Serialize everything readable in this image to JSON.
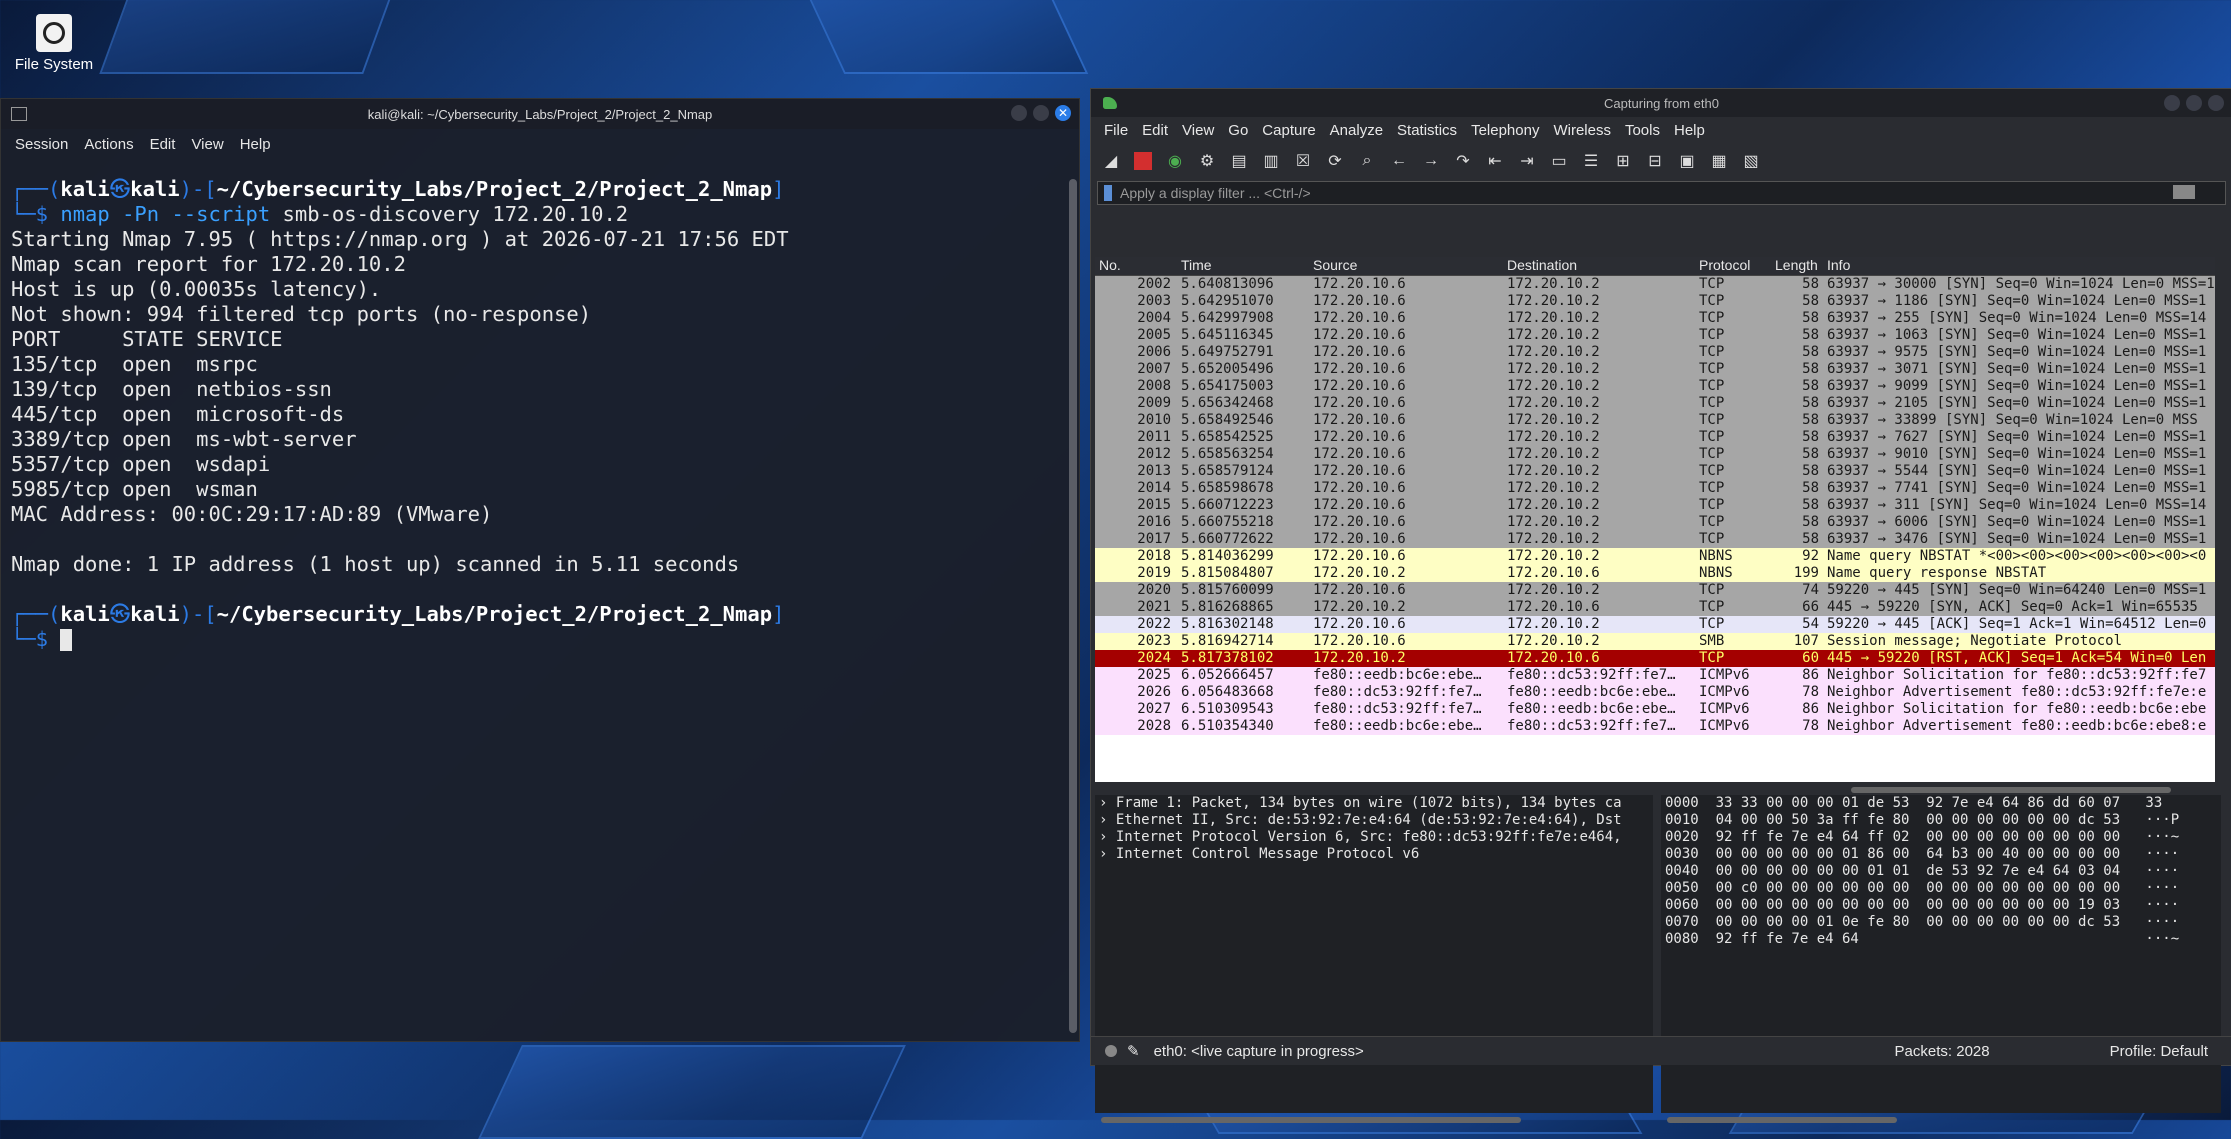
{
  "desktop": {
    "icon_label": "File System"
  },
  "terminal": {
    "title": "kali@kali: ~/Cybersecurity_Labs/Project_2/Project_2_Nmap",
    "menu": [
      "Session",
      "Actions",
      "Edit",
      "View",
      "Help"
    ],
    "prompt_user": "kali",
    "prompt_host": "kali",
    "prompt_path": "~/Cybersecurity_Labs/Project_2/Project_2_Nmap",
    "command_bin": "nmap",
    "command_args": "-Pn --script",
    "command_rest": "smb-os-discovery 172.20.10.2",
    "output": [
      "Starting Nmap 7.95 ( https://nmap.org ) at 2026-07-21 17:56 EDT",
      "Nmap scan report for 172.20.10.2",
      "Host is up (0.00035s latency).",
      "Not shown: 994 filtered tcp ports (no-response)",
      "PORT     STATE SERVICE",
      "135/tcp  open  msrpc",
      "139/tcp  open  netbios-ssn",
      "445/tcp  open  microsoft-ds",
      "3389/tcp open  ms-wbt-server",
      "5357/tcp open  wsdapi",
      "5985/tcp open  wsman",
      "MAC Address: 00:0C:29:17:AD:89 (VMware)",
      "",
      "Nmap done: 1 IP address (1 host up) scanned in 5.11 seconds"
    ]
  },
  "wireshark": {
    "title": "Capturing from eth0",
    "menu": [
      "File",
      "Edit",
      "View",
      "Go",
      "Capture",
      "Analyze",
      "Statistics",
      "Telephony",
      "Wireless",
      "Tools",
      "Help"
    ],
    "filter_placeholder": "Apply a display filter ... <Ctrl-/>",
    "columns": [
      "No.",
      "Time",
      "Source",
      "Destination",
      "Protocol",
      "Length",
      "Info"
    ],
    "packets": [
      {
        "no": "2002",
        "time": "5.640813096",
        "src": "172.20.10.6",
        "dst": "172.20.10.2",
        "proto": "TCP",
        "len": "58",
        "info": "63937 → 30000 [SYN] Seq=0 Win=1024 Len=0 MSS=1",
        "color": "#a6a6a6"
      },
      {
        "no": "2003",
        "time": "5.642951070",
        "src": "172.20.10.6",
        "dst": "172.20.10.2",
        "proto": "TCP",
        "len": "58",
        "info": "63937 → 1186 [SYN] Seq=0 Win=1024 Len=0 MSS=1",
        "color": "#a6a6a6"
      },
      {
        "no": "2004",
        "time": "5.642997908",
        "src": "172.20.10.6",
        "dst": "172.20.10.2",
        "proto": "TCP",
        "len": "58",
        "info": "63937 → 255 [SYN] Seq=0 Win=1024 Len=0 MSS=14",
        "color": "#a6a6a6"
      },
      {
        "no": "2005",
        "time": "5.645116345",
        "src": "172.20.10.6",
        "dst": "172.20.10.2",
        "proto": "TCP",
        "len": "58",
        "info": "63937 → 1063 [SYN] Seq=0 Win=1024 Len=0 MSS=1",
        "color": "#a6a6a6"
      },
      {
        "no": "2006",
        "time": "5.649752791",
        "src": "172.20.10.6",
        "dst": "172.20.10.2",
        "proto": "TCP",
        "len": "58",
        "info": "63937 → 9575 [SYN] Seq=0 Win=1024 Len=0 MSS=1",
        "color": "#a6a6a6"
      },
      {
        "no": "2007",
        "time": "5.652005496",
        "src": "172.20.10.6",
        "dst": "172.20.10.2",
        "proto": "TCP",
        "len": "58",
        "info": "63937 → 3071 [SYN] Seq=0 Win=1024 Len=0 MSS=1",
        "color": "#a6a6a6"
      },
      {
        "no": "2008",
        "time": "5.654175003",
        "src": "172.20.10.6",
        "dst": "172.20.10.2",
        "proto": "TCP",
        "len": "58",
        "info": "63937 → 9099 [SYN] Seq=0 Win=1024 Len=0 MSS=1",
        "color": "#a6a6a6"
      },
      {
        "no": "2009",
        "time": "5.656342468",
        "src": "172.20.10.6",
        "dst": "172.20.10.2",
        "proto": "TCP",
        "len": "58",
        "info": "63937 → 2105 [SYN] Seq=0 Win=1024 Len=0 MSS=1",
        "color": "#a6a6a6"
      },
      {
        "no": "2010",
        "time": "5.658492546",
        "src": "172.20.10.6",
        "dst": "172.20.10.2",
        "proto": "TCP",
        "len": "58",
        "info": "63937 → 33899 [SYN] Seq=0 Win=1024 Len=0 MSS",
        "color": "#a6a6a6"
      },
      {
        "no": "2011",
        "time": "5.658542525",
        "src": "172.20.10.6",
        "dst": "172.20.10.2",
        "proto": "TCP",
        "len": "58",
        "info": "63937 → 7627 [SYN] Seq=0 Win=1024 Len=0 MSS=1",
        "color": "#a6a6a6"
      },
      {
        "no": "2012",
        "time": "5.658563254",
        "src": "172.20.10.6",
        "dst": "172.20.10.2",
        "proto": "TCP",
        "len": "58",
        "info": "63937 → 9010 [SYN] Seq=0 Win=1024 Len=0 MSS=1",
        "color": "#a6a6a6"
      },
      {
        "no": "2013",
        "time": "5.658579124",
        "src": "172.20.10.6",
        "dst": "172.20.10.2",
        "proto": "TCP",
        "len": "58",
        "info": "63937 → 5544 [SYN] Seq=0 Win=1024 Len=0 MSS=1",
        "color": "#a6a6a6"
      },
      {
        "no": "2014",
        "time": "5.658598678",
        "src": "172.20.10.6",
        "dst": "172.20.10.2",
        "proto": "TCP",
        "len": "58",
        "info": "63937 → 7741 [SYN] Seq=0 Win=1024 Len=0 MSS=1",
        "color": "#a6a6a6"
      },
      {
        "no": "2015",
        "time": "5.660712223",
        "src": "172.20.10.6",
        "dst": "172.20.10.2",
        "proto": "TCP",
        "len": "58",
        "info": "63937 → 311 [SYN] Seq=0 Win=1024 Len=0 MSS=14",
        "color": "#a6a6a6"
      },
      {
        "no": "2016",
        "time": "5.660755218",
        "src": "172.20.10.6",
        "dst": "172.20.10.2",
        "proto": "TCP",
        "len": "58",
        "info": "63937 → 6006 [SYN] Seq=0 Win=1024 Len=0 MSS=1",
        "color": "#a6a6a6"
      },
      {
        "no": "2017",
        "time": "5.660772622",
        "src": "172.20.10.6",
        "dst": "172.20.10.2",
        "proto": "TCP",
        "len": "58",
        "info": "63937 → 3476 [SYN] Seq=0 Win=1024 Len=0 MSS=1",
        "color": "#a6a6a6"
      },
      {
        "no": "2018",
        "time": "5.814036299",
        "src": "172.20.10.6",
        "dst": "172.20.10.2",
        "proto": "NBNS",
        "len": "92",
        "info": "Name query NBSTAT *<00><00><00><00><00><00><0",
        "color": "#fefec4"
      },
      {
        "no": "2019",
        "time": "5.815084807",
        "src": "172.20.10.2",
        "dst": "172.20.10.6",
        "proto": "NBNS",
        "len": "199",
        "info": "Name query response NBSTAT",
        "color": "#fefec4"
      },
      {
        "no": "2020",
        "time": "5.815760099",
        "src": "172.20.10.6",
        "dst": "172.20.10.2",
        "proto": "TCP",
        "len": "74",
        "info": "59220 → 445 [SYN] Seq=0 Win=64240 Len=0 MSS=1",
        "color": "#a6a6a6"
      },
      {
        "no": "2021",
        "time": "5.816268865",
        "src": "172.20.10.2",
        "dst": "172.20.10.6",
        "proto": "TCP",
        "len": "66",
        "info": "445 → 59220 [SYN, ACK] Seq=0 Ack=1 Win=65535",
        "color": "#a6a6a6"
      },
      {
        "no": "2022",
        "time": "5.816302148",
        "src": "172.20.10.6",
        "dst": "172.20.10.2",
        "proto": "TCP",
        "len": "54",
        "info": "59220 → 445 [ACK] Seq=1 Ack=1 Win=64512 Len=0",
        "color": "#e6e6f8"
      },
      {
        "no": "2023",
        "time": "5.816942714",
        "src": "172.20.10.6",
        "dst": "172.20.10.2",
        "proto": "SMB",
        "len": "107",
        "info": "Session message; Negotiate Protocol",
        "color": "#fefec4"
      },
      {
        "no": "2024",
        "time": "5.817378102",
        "src": "172.20.10.2",
        "dst": "172.20.10.6",
        "proto": "TCP",
        "len": "60",
        "info": "445 → 59220 [RST, ACK] Seq=1 Ack=54 Win=0 Len",
        "color": "#a40000",
        "fg": "#ffff66"
      },
      {
        "no": "2025",
        "time": "6.052666457",
        "src": "fe80::eedb:bc6e:ebe…",
        "dst": "fe80::dc53:92ff:fe7…",
        "proto": "ICMPv6",
        "len": "86",
        "info": "Neighbor Solicitation for fe80::dc53:92ff:fe7",
        "color": "#fbe0fd"
      },
      {
        "no": "2026",
        "time": "6.056483668",
        "src": "fe80::dc53:92ff:fe7…",
        "dst": "fe80::eedb:bc6e:ebe…",
        "proto": "ICMPv6",
        "len": "78",
        "info": "Neighbor Advertisement fe80::dc53:92ff:fe7e:e",
        "color": "#fbe0fd"
      },
      {
        "no": "2027",
        "time": "6.510309543",
        "src": "fe80::dc53:92ff:fe7…",
        "dst": "fe80::eedb:bc6e:ebe…",
        "proto": "ICMPv6",
        "len": "86",
        "info": "Neighbor Solicitation for fe80::eedb:bc6e:ebe",
        "color": "#fbe0fd"
      },
      {
        "no": "2028",
        "time": "6.510354340",
        "src": "fe80::eedb:bc6e:ebe…",
        "dst": "fe80::dc53:92ff:fe7…",
        "proto": "ICMPv6",
        "len": "78",
        "info": "Neighbor Advertisement fe80::eedb:bc6e:ebe8:e",
        "color": "#fbe0fd"
      }
    ],
    "details": [
      "Frame 1: Packet, 134 bytes on wire (1072 bits), 134 bytes ca",
      "Ethernet II, Src: de:53:92:7e:e4:64 (de:53:92:7e:e4:64), Dst",
      "Internet Protocol Version 6, Src: fe80::dc53:92ff:fe7e:e464,",
      "Internet Control Message Protocol v6"
    ],
    "hex": [
      "0000  33 33 00 00 00 01 de 53  92 7e e4 64 86 dd 60 07   33",
      "0010  04 00 00 50 3a ff fe 80  00 00 00 00 00 00 dc 53   ···P",
      "0020  92 ff fe 7e e4 64 ff 02  00 00 00 00 00 00 00 00   ···~",
      "0030  00 00 00 00 00 01 86 00  64 b3 00 40 00 00 00 00   ····",
      "0040  00 00 00 00 00 00 01 01  de 53 92 7e e4 64 03 04   ····",
      "0050  00 c0 00 00 00 00 00 00  00 00 00 00 00 00 00 00   ····",
      "0060  00 00 00 00 00 00 00 00  00 00 00 00 00 00 19 03   ····",
      "0070  00 00 00 00 01 0e fe 80  00 00 00 00 00 00 dc 53   ····",
      "0080  92 ff fe 7e e4 64                                  ···~"
    ],
    "status_iface": "eth0: <live capture in progress>",
    "status_packets": "Packets: 2028",
    "status_profile": "Profile: Default"
  }
}
